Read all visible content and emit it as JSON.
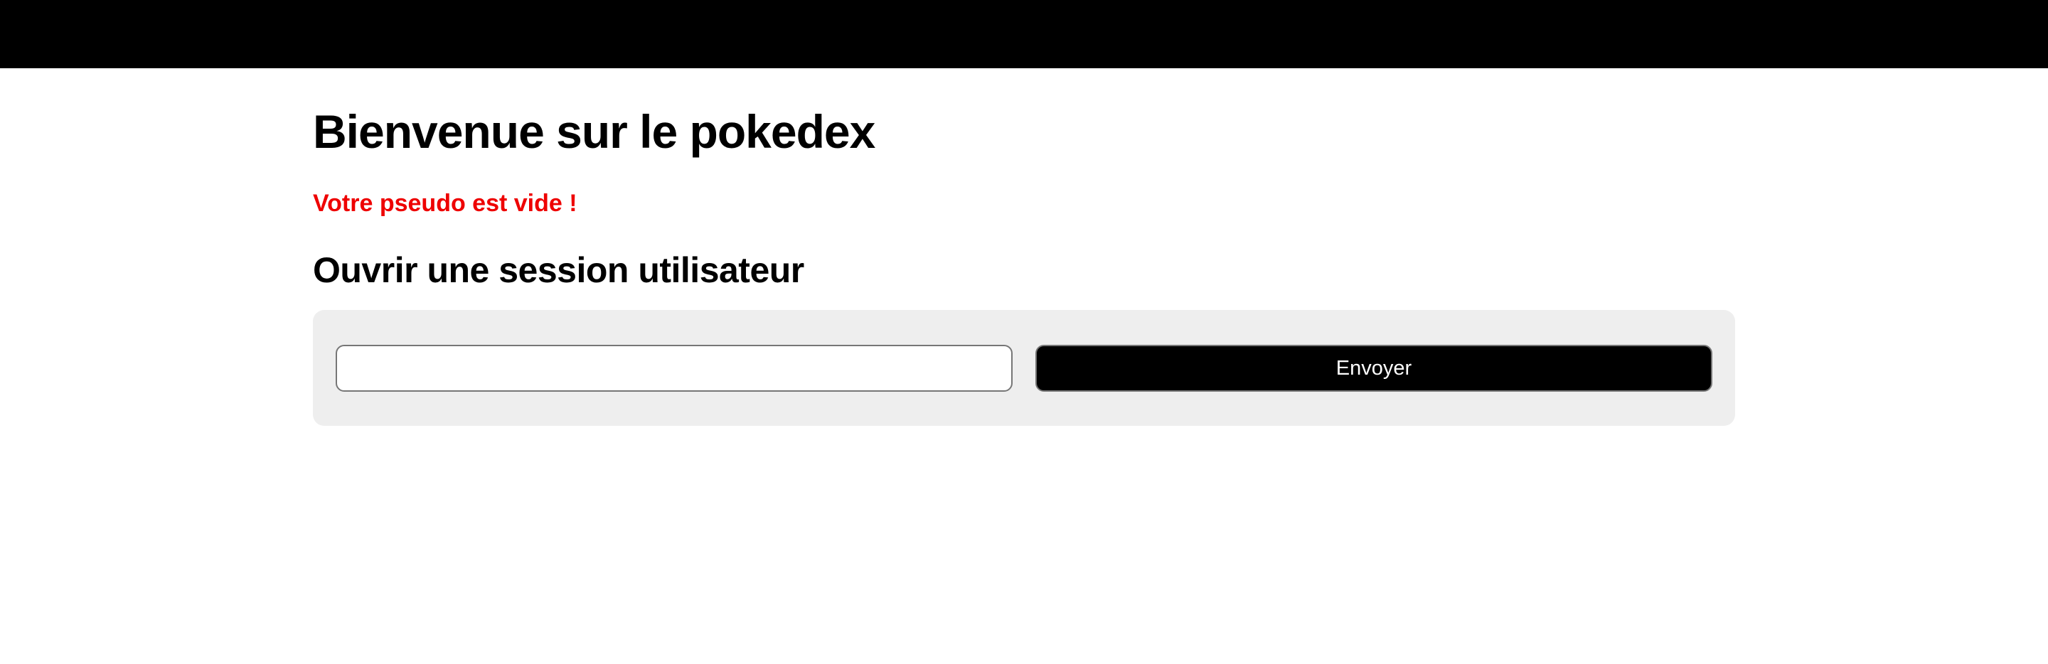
{
  "header": {
    "background_color": "#000000"
  },
  "main": {
    "title": "Bienvenue sur le pokedex",
    "error_message": "Votre pseudo est vide !",
    "error_color": "#ee0000",
    "section_title": "Ouvrir une session utilisateur"
  },
  "form": {
    "pseudo_value": "",
    "pseudo_placeholder": "",
    "submit_label": "Envoyer"
  }
}
